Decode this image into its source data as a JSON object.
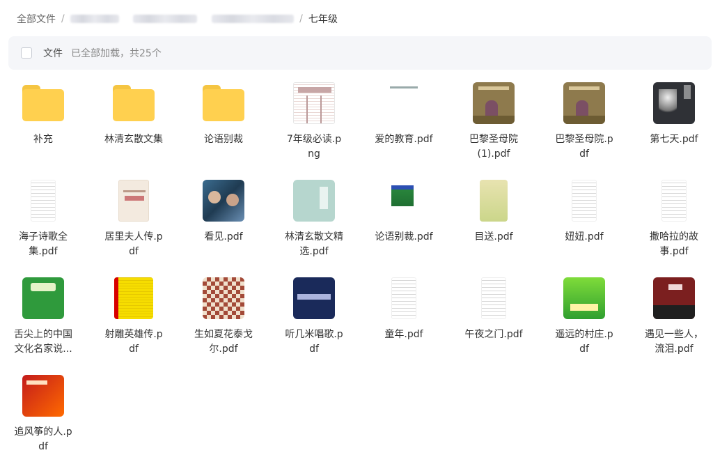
{
  "breadcrumb": {
    "root": "全部文件",
    "current": "七年级"
  },
  "toolbar": {
    "label": "文件",
    "status": "已全部加载，共25个"
  },
  "items": [
    {
      "name": "补充",
      "type": "folder"
    },
    {
      "name": "林清玄散文集",
      "type": "folder"
    },
    {
      "name": "论语别裁",
      "type": "folder"
    },
    {
      "name": "7年级必读.png",
      "type": "doc-table"
    },
    {
      "name": "爱的教育.pdf",
      "type": "doc-white"
    },
    {
      "name": "巴黎圣母院(1).pdf",
      "type": "cover-paris"
    },
    {
      "name": "巴黎圣母院.pdf",
      "type": "cover-paris"
    },
    {
      "name": "第七天.pdf",
      "type": "cover-dark"
    },
    {
      "name": "海子诗歌全集.pdf",
      "type": "doc-text"
    },
    {
      "name": "居里夫人传.pdf",
      "type": "cover-beige"
    },
    {
      "name": "看见.pdf",
      "type": "cover-photo"
    },
    {
      "name": "林清玄散文精选.pdf",
      "type": "cover-teal"
    },
    {
      "name": "论语别裁.pdf",
      "type": "cover-green-small"
    },
    {
      "name": "目送.pdf",
      "type": "cover-yellowgreen"
    },
    {
      "name": "妞妞.pdf",
      "type": "doc-text"
    },
    {
      "name": "撒哈拉的故事.pdf",
      "type": "doc-text"
    },
    {
      "name": "舌尖上的中国文化名家说...",
      "type": "cover-green"
    },
    {
      "name": "射雕英雄传.pdf",
      "type": "cover-yellow"
    },
    {
      "name": "生如夏花泰戈尔.pdf",
      "type": "cover-pattern"
    },
    {
      "name": "听几米唱歌.pdf",
      "type": "cover-navy"
    },
    {
      "name": "童年.pdf",
      "type": "doc-text"
    },
    {
      "name": "午夜之门.pdf",
      "type": "doc-text"
    },
    {
      "name": "遥远的村庄.pdf",
      "type": "cover-village"
    },
    {
      "name": "遇见一些人，流泪.pdf",
      "type": "cover-red"
    },
    {
      "name": "追风筝的人.pdf",
      "type": "cover-kite"
    }
  ]
}
